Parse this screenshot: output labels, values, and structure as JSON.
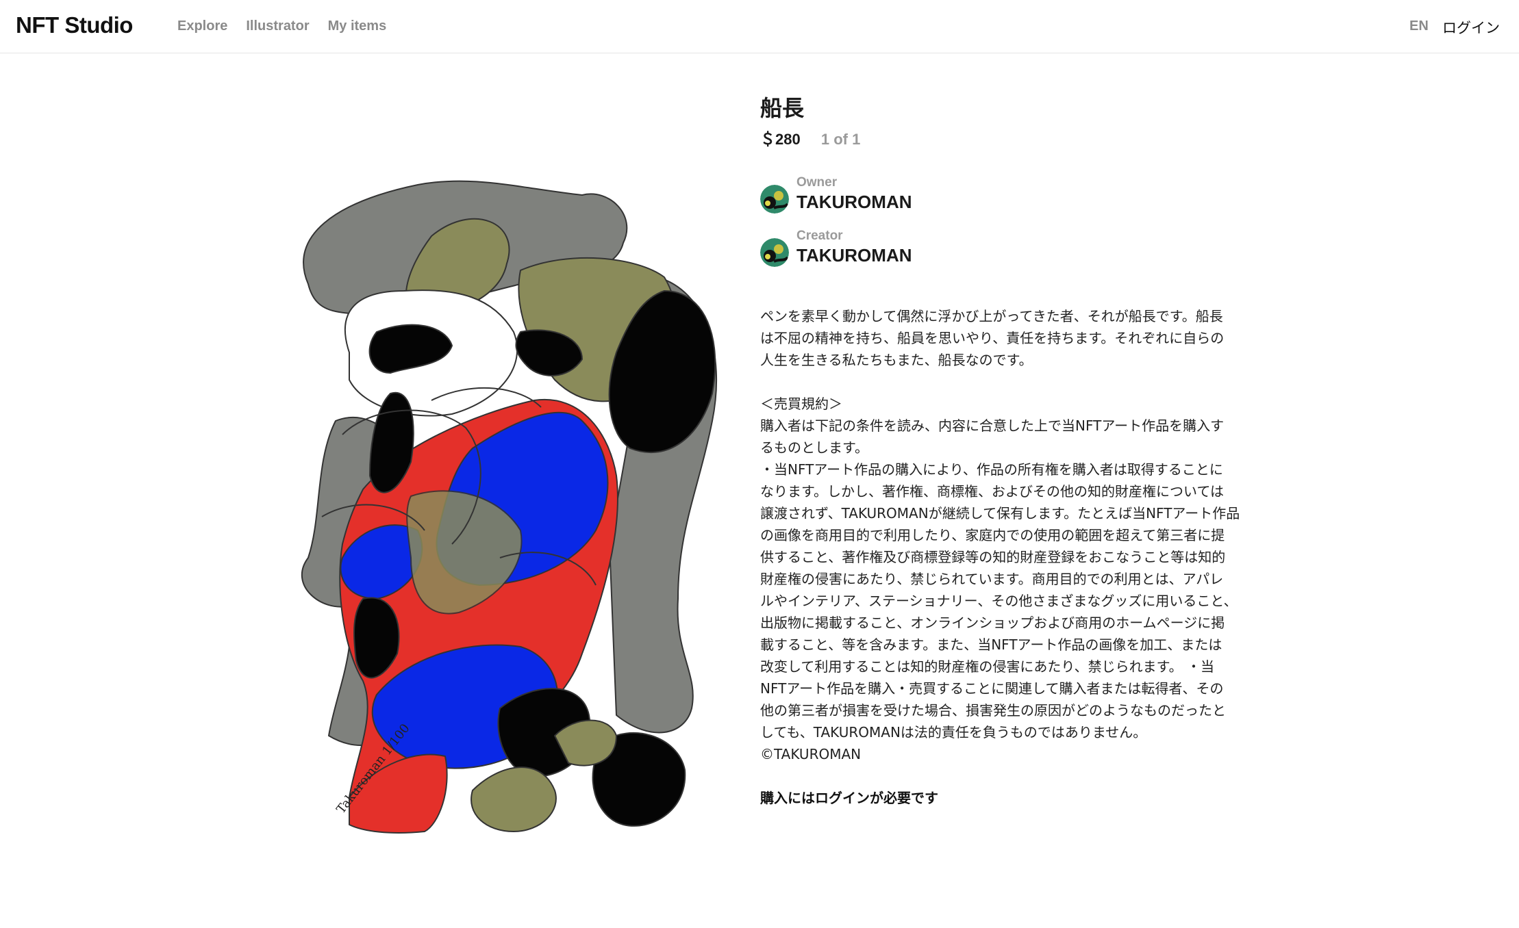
{
  "header": {
    "logo": "NFT Studio",
    "nav": [
      {
        "label": "Explore"
      },
      {
        "label": "Illustrator"
      },
      {
        "label": "My items"
      }
    ],
    "lang": "EN",
    "login": "ログイン"
  },
  "artwork": {
    "signature": "Takuroman 1/100",
    "colors": {
      "gray": "#7f817d",
      "olive": "#8a8b5a",
      "red": "#e4302a",
      "blue": "#0a28e6",
      "black": "#050505"
    }
  },
  "item": {
    "title": "船長",
    "price": "＄280",
    "edition": "1 of 1",
    "owner": {
      "role": "Owner",
      "name": "TAKUROMAN"
    },
    "creator": {
      "role": "Creator",
      "name": "TAKUROMAN"
    },
    "description_lines": [
      "ペンを素早く動かして偶然に浮かび上がってきた者、それが船長です。船長",
      "は不屈の精神を持ち、船員を思いやり、責任を持ちます。それぞれに自らの",
      "人生を生きる私たちもまた、船長なのです。",
      "",
      "＜売買規約＞",
      "購入者は下記の条件を読み、内容に合意した上で当NFTアート作品を購入す",
      "るものとします。",
      "・当NFTアート作品の購入により、作品の所有権を購入者は取得することに",
      "なります。しかし、著作権、商標権、およびその他の知的財産権については",
      "譲渡されず、TAKUROMANが継続して保有します。たとえば当NFTアート作品",
      "の画像を商用目的で利用したり、家庭内での使用の範囲を超えて第三者に提",
      "供すること、著作権及び商標登録等の知的財産登録をおこなうこと等は知的",
      "財産権の侵害にあたり、禁じられています。商用目的での利用とは、アパレ",
      "ルやインテリア、ステーショナリー、その他さまざまなグッズに用いること、",
      "出版物に掲載すること、オンラインショップおよび商用のホームページに掲",
      "載すること、等を含みます。また、当NFTアート作品の画像を加工、または",
      "改変して利用することは知的財産権の侵害にあたり、禁じられます。 ・当",
      "NFTアート作品を購入・売買することに関連して購入者または転得者、その",
      "他の第三者が損害を受けた場合、損害発生の原因がどのようなものだったと",
      "しても、TAKUROMANは法的責任を負うものではありません。",
      "©TAKUROMAN"
    ],
    "login_notice": "購入にはログインが必要です"
  }
}
